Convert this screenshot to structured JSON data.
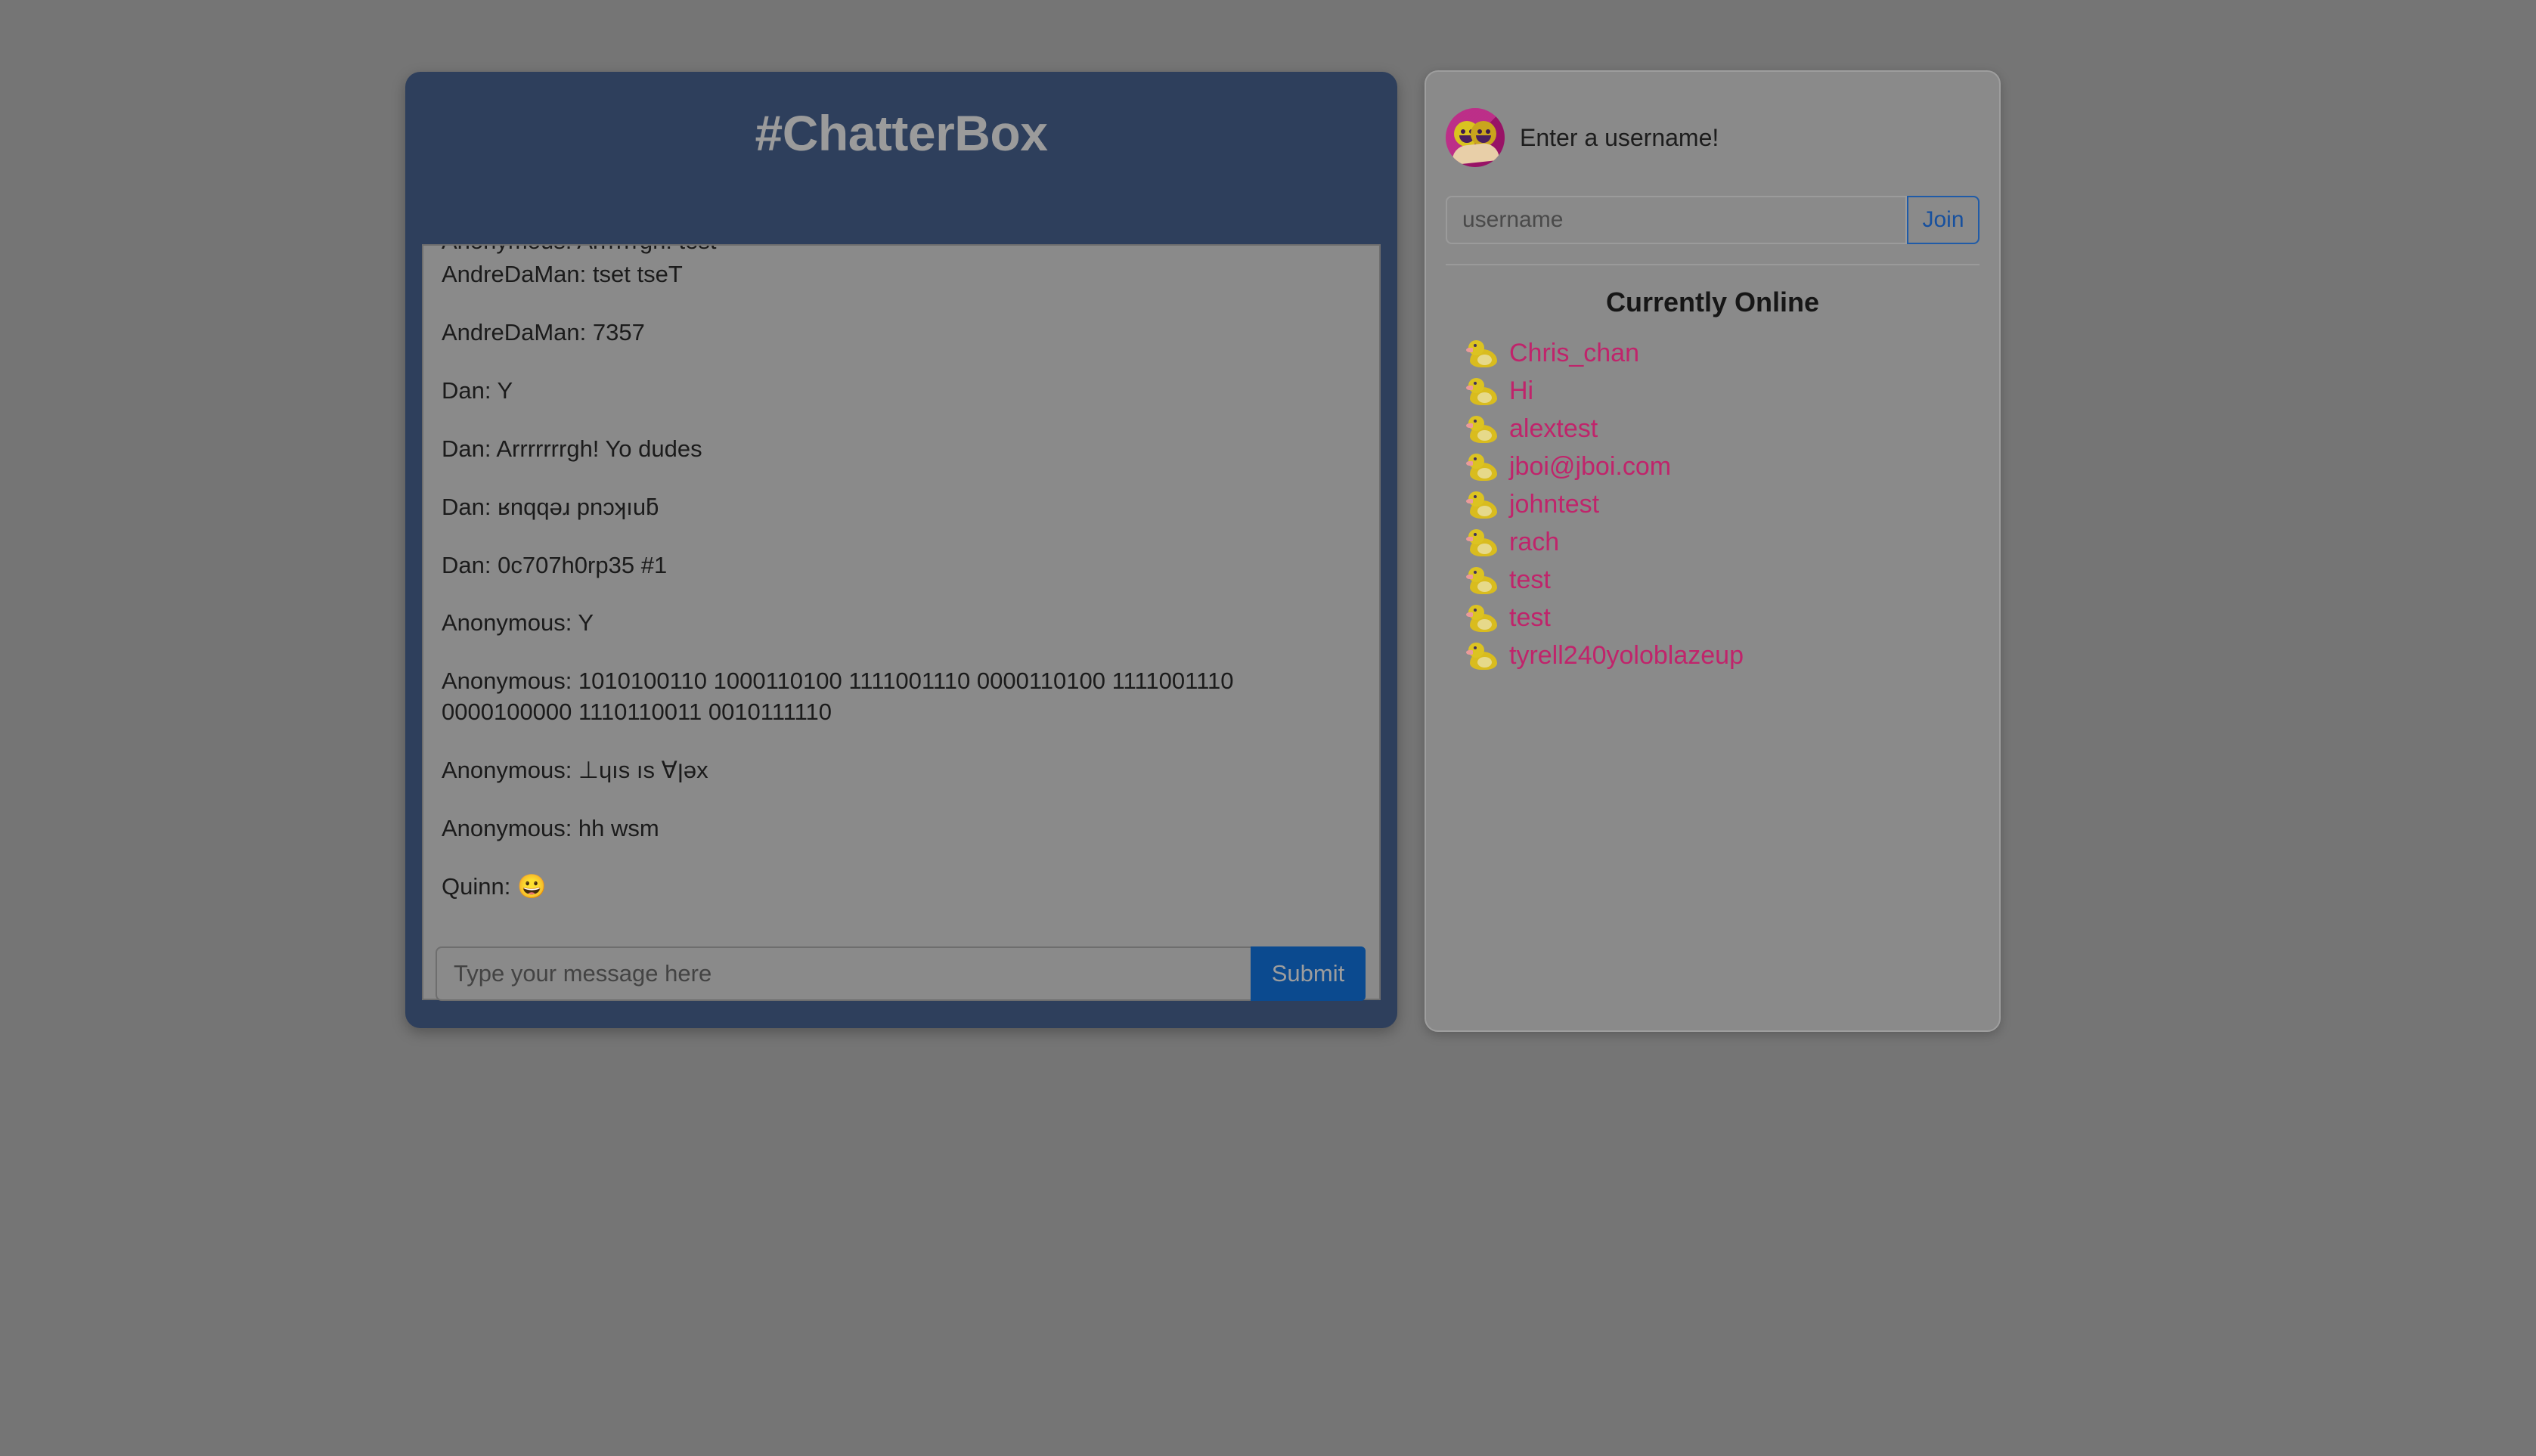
{
  "chat": {
    "title": "#ChatterBox",
    "messages": [
      "Anonymous: Arrrrrrgh! test",
      "AndreDaMan: tset tseT",
      "AndreDaMan: 7357",
      "Dan: Y",
      "Dan: Arrrrrrrgh! Yo dudes",
      "Dan: ʁnqqǝɹ pnɔʞıuƃ",
      "Dan: 0c707h0rp35 #1",
      "Anonymous: Y",
      "Anonymous: 1010100110 1000110100 1111001110 0000110100 1111001110 0000100000 1110110011 0010111110",
      "Anonymous: ⊥ɥıs ıs ∀ןǝx",
      "Anonymous: hh wsm",
      "Quinn: 😀"
    ],
    "composer": {
      "placeholder": "Type your message here",
      "submit_label": "Submit"
    }
  },
  "sidebar": {
    "prompt": "Enter a username!",
    "avatar_icon": "people-masks-icon",
    "username_placeholder": "username",
    "username_value": "",
    "join_label": "Join",
    "online_title": "Currently Online",
    "online_users": [
      "Chris_chan",
      "Hi",
      "alextest",
      "jboi@jboi.com",
      "johntest",
      "rach",
      "test",
      "test",
      "tyrell240yoloblazeup"
    ],
    "user_icon": "duck-icon"
  },
  "colors": {
    "overlay": "#757575",
    "chat_card": "#2e3f5c",
    "chat_title": "#9b9b9b",
    "submit_button": "#0b4a8f",
    "join_text": "#17509e",
    "username_link": "#c0246b",
    "avatar_circle": "#b5177a"
  }
}
